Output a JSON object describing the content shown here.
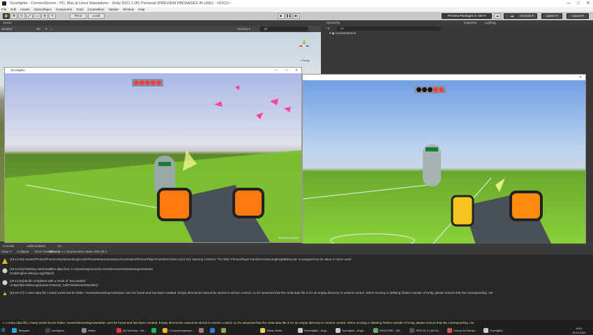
{
  "window": {
    "title": "Sccelighto - ConnectScene - PC, Mac & Linux Standalone - Unity 2021.1.0f1 Personal (PREVIEW PACKAGES IN USE) - <DX11>",
    "minimize": "—",
    "maximize": "□",
    "close": "✕"
  },
  "menubar": [
    "File",
    "Edit",
    "Assets",
    "GameObject",
    "Component",
    "Tools",
    "Contentlitos",
    "Tabular",
    "Window",
    "Help"
  ],
  "toolbar": {
    "pivot": "Pivot",
    "local": "Local",
    "preview_packages": "Preview Packages in Use ▾",
    "account": "Account ▾",
    "layers": "Layers ▾",
    "layout": "Layout ▾"
  },
  "scene": {
    "tab": "Scene",
    "shading": "Shaded",
    "mode_2d": "2D",
    "gizmos": "Gizmos ▾",
    "search_placeholder": "All",
    "persp": "< Persp"
  },
  "hierarchy": {
    "tab": "Hierarchy",
    "search_placeholder": "All",
    "item": "ConnectScene",
    "plus": "+ ▾"
  },
  "inspector": {
    "tab1": "Inspector",
    "tab2": "Lighting"
  },
  "game1": {
    "title": "Sccelighto",
    "watermark": "Development Build"
  },
  "game2": {
    "title": "",
    "watermark": "Development Build"
  },
  "console": {
    "tabs": [
      "Console",
      "Addressables",
      "Ani"
    ],
    "clear": "Clear ▾",
    "collapse": "Collapse",
    "error_pause": "Error Pause",
    "editor": "Editor ▾",
    "counts": "Density 4   1 lerp/secdory steam 305 KB  1",
    "rows": [
      {
        "icon_color": "#e8b923",
        "text": "[18:13:48] Assets\\Photon\\PhotonUnityNetworking\\Code\\PhotonExtensions\\Synchronization\\PhotonPlayerTransformView.cs(12,24): warning CS0414: The field 'PhotonPlayerTransformView.angleUpdatesLerp' is assigned but its value is never used"
      },
      {
        "icon_color": "#cfcfcf",
        "text": "[18:13:54] Deleting Addressables data from C:/repos/majmusic/Szczeszkie/Assets/StreamingAssets/aa",
        "text2": "UnityEngine.Debug:Log(Object)"
      },
      {
        "icon_color": "#cfcfcf",
        "text": "[18:13:54] Build completed with a result of 'Succeeded'",
        "text2": "UnityEditor.EditorApplication:Internal_CallGlobalEventHandler()"
      },
      {
        "icon_color": "#e8b923",
        "text": "[18:19:47] A meta data file (.meta) exists but its folder 'Assets/StreamingAssets/aa' can't be found and has been created. Empty directories cannot be stored in version control, so it's assumed that the meta data file is for an empty directory in version control. When moving or deleting folders outside of Unity, please ensure that the corresponding .me"
      }
    ]
  },
  "statusbar": "⚠ A meta data file (.meta) exists but its folder 'Assets/StreamingAssets/aa' can't be found and has been created. Empty directories cannot be stored in version control, so it's assumed that the meta data file is for an empty directory in version control. When moving or deleting folders outside of Unity, please ensure that the corresponding .me",
  "taskbar": {
    "items": [
      {
        "label": "Telegram",
        "color": "#2ca5e0"
      },
      {
        "label": "sccelighto",
        "color": "#444"
      },
      {
        "label": "Widen",
        "color": "#888"
      },
      {
        "label": "(8) YouTube - Mo...",
        "color": "#e33"
      },
      {
        "label": "",
        "color": "#1db954"
      },
      {
        "label": "C:\\repos\\majmusic...",
        "color": "#e8b923"
      },
      {
        "label": "",
        "color": "#a77"
      },
      {
        "label": "",
        "color": "#2a82d9"
      },
      {
        "label": "",
        "color": "#8a5"
      },
      {
        "label": "Sticky Notes",
        "color": "#e8d44d"
      },
      {
        "label": "Szczelighto - Angl...",
        "color": "#ccc"
      },
      {
        "label": "Sccelighto - Angli...",
        "color": "#ccc"
      },
      {
        "label": "NSSCORE - (50...",
        "color": "#6a6"
      },
      {
        "label": "OBS 22.1.0 (64-bi...",
        "color": "#333"
      },
      {
        "label": "Cenny Za Pokoju...",
        "color": "#c55"
      },
      {
        "label": "Sccelighto",
        "color": "#ccc"
      }
    ],
    "time": "18:21",
    "date": "30.10.2020"
  }
}
